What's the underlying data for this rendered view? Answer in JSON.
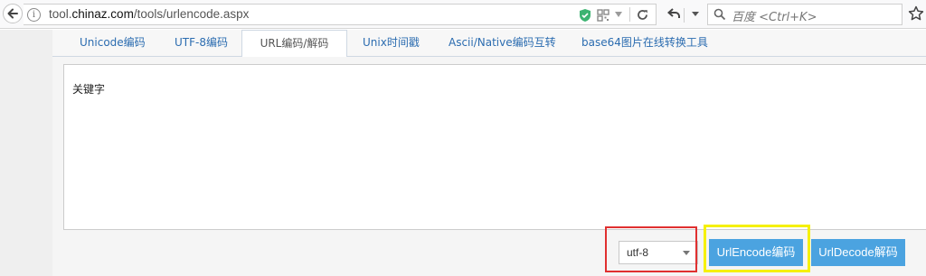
{
  "browser": {
    "url_prefix": "tool.",
    "url_host": "chinaz.com",
    "url_path": "/tools/urlencode.aspx",
    "info_icon": "i",
    "search_placeholder": "百度 <Ctrl+K>",
    "icons": [
      "back-arrow-icon",
      "info-icon",
      "shield-icon",
      "qr-code-icon",
      "dropdown-icon",
      "reload-icon",
      "undo-icon",
      "search-icon",
      "star-icon"
    ]
  },
  "tabs": [
    {
      "label": "Unicode编码",
      "active": false
    },
    {
      "label": "UTF-8编码",
      "active": false
    },
    {
      "label": "URL编码/解码",
      "active": true
    },
    {
      "label": "Unix时间戳",
      "active": false
    },
    {
      "label": "Ascii/Native编码互转",
      "active": false
    },
    {
      "label": "base64图片在线转换工具",
      "active": false
    }
  ],
  "editor": {
    "value": "关键字"
  },
  "charset_select": {
    "selected": "utf-8"
  },
  "actions": {
    "encode_label": "UrlEncode编码",
    "decode_label": "UrlDecode解码"
  },
  "colors": {
    "tab_link": "#2b6cb0",
    "button": "#4ba3e0",
    "highlight_red": "#e03030",
    "highlight_yellow": "#f5f000"
  }
}
